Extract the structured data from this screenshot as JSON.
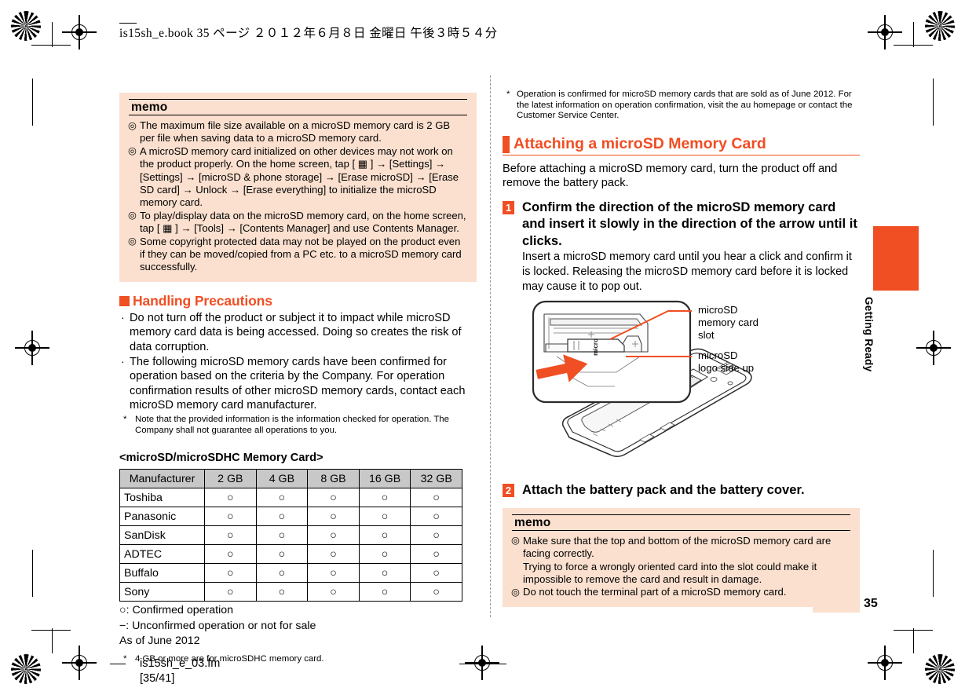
{
  "slug": {
    "top": "is15sh_e.book   35 ページ   ２０１２年６月８日   金曜日   午後３時５４分",
    "file": "is15sh_e_03.fm",
    "pages": "[35/41]"
  },
  "page_number": "35",
  "side_tab": {
    "label": "Getting Ready"
  },
  "colors": {
    "accent": "#f04e23",
    "memo_bg": "#fbe0cf",
    "table_header_bg": "#c8c8c8"
  },
  "left_column": {
    "memo": {
      "title": "memo",
      "items": [
        "The maximum file size available on a microSD memory card is 2 GB per file when saving data to a microSD memory card.",
        "A microSD memory card initialized on other devices may not work on the product properly. On the home screen, tap [ ▦ ] → [Settings] → [Settings] → [microSD & phone storage] → [Erase microSD] → [Erase SD card] → Unlock → [Erase everything] to initialize the microSD memory card.",
        "To play/display data on the microSD memory card, on the home screen, tap [ ▦ ] → [Tools] → [Contents Manager] and use Contents Manager.",
        "Some copyright protected data may not be played on the product even if they can be moved/copied from a PC etc. to a microSD memory card successfully."
      ]
    },
    "precautions": {
      "heading": "Handling Precautions",
      "bullets": [
        "Do not turn off the product or subject it to impact while microSD memory card data is being accessed. Doing so creates the risk of data corruption.",
        "The following microSD memory cards have been confirmed for operation based on the criteria by the Company. For operation confirmation results of other microSD memory cards, contact each microSD memory card manufacturer."
      ],
      "footnote": "Note that the provided information is the information checked for operation. The Company shall not guarantee all operations to you."
    },
    "table": {
      "caption": "<microSD/microSDHC Memory Card>",
      "columns": [
        "Manufacturer",
        "2 GB",
        "4 GB",
        "8 GB",
        "16 GB",
        "32 GB"
      ],
      "rows": [
        {
          "manufacturer": "Toshiba",
          "values": [
            "○",
            "○",
            "○",
            "○",
            "○"
          ]
        },
        {
          "manufacturer": "Panasonic",
          "values": [
            "○",
            "○",
            "○",
            "○",
            "○"
          ]
        },
        {
          "manufacturer": "SanDisk",
          "values": [
            "○",
            "○",
            "○",
            "○",
            "○"
          ]
        },
        {
          "manufacturer": "ADTEC",
          "values": [
            "○",
            "○",
            "○",
            "○",
            "○"
          ]
        },
        {
          "manufacturer": "Buffalo",
          "values": [
            "○",
            "○",
            "○",
            "○",
            "○"
          ]
        },
        {
          "manufacturer": "Sony",
          "values": [
            "○",
            "○",
            "○",
            "○",
            "○"
          ]
        }
      ],
      "legend": [
        "○: Confirmed operation",
        "−: Unconfirmed operation or not for sale",
        "As of June 2012"
      ],
      "footnote": "4 GB or more are for microSDHC memory card."
    }
  },
  "right_column": {
    "top_footnote": "Operation is confirmed for microSD memory cards that are sold as of June 2012. For the latest information on operation confirmation, visit the au homepage or contact the Customer Service Center.",
    "section_heading": "Attaching a microSD Memory Card",
    "intro": "Before attaching a microSD memory card, turn the product off and remove the battery pack.",
    "steps": [
      {
        "num": "1",
        "title": "Confirm the direction of the microSD memory card and insert it slowly in the direction of the arrow until it clicks.",
        "body": "Insert a microSD memory card until you hear a click and confirm it is locked. Releasing the microSD memory card before it is locked may cause it to pop out."
      },
      {
        "num": "2",
        "title": "Attach the battery pack and the battery cover.",
        "body": ""
      }
    ],
    "figure": {
      "callout_1": "microSD\nmemory card\nslot",
      "callout_1_line1": "microSD",
      "callout_1_line2": "memory card",
      "callout_1_line3": "slot",
      "callout_2_line1": "microSD",
      "callout_2_line2": "logo side up",
      "card_logo": "micro"
    },
    "memo": {
      "title": "memo",
      "items": [
        "Make sure that the top and bottom of the microSD memory card are facing correctly.",
        "Do not touch the terminal part of a microSD memory card."
      ],
      "sub_lines": [
        "Trying to force a wrongly oriented card into the slot could make it",
        "impossible to remove the card and result in damage."
      ]
    }
  }
}
